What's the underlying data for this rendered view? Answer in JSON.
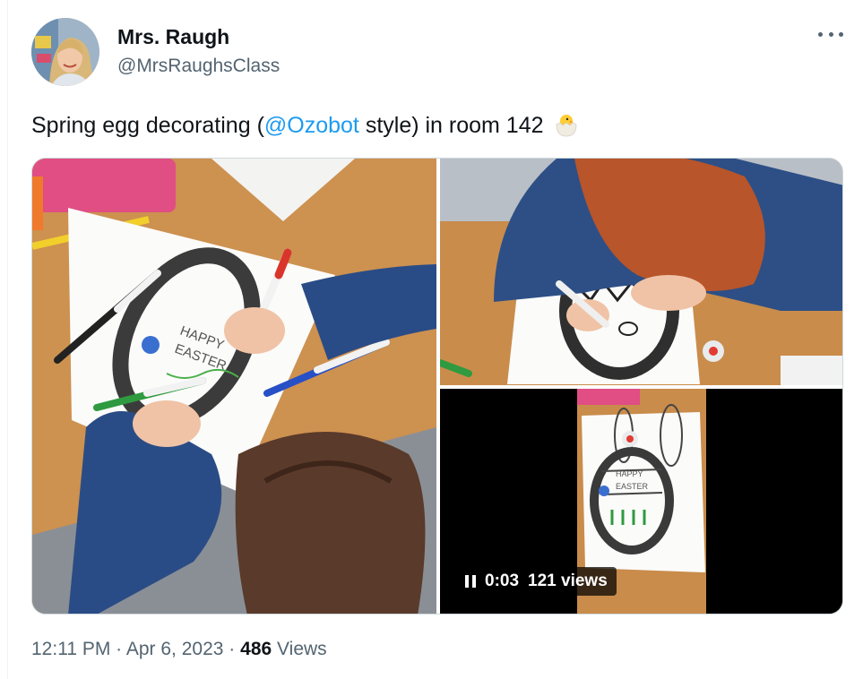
{
  "author": {
    "name": "Mrs. Raugh",
    "handle": "@MrsRaughsClass"
  },
  "tweet": {
    "text_before": "Spring egg decorating (",
    "mention": "@Ozobot",
    "text_after": " style) in room 142",
    "emoji": "hatching-chick-icon"
  },
  "media": {
    "video": {
      "time": "0:03",
      "views": "121 views"
    }
  },
  "meta": {
    "time": "12:11 PM",
    "separator": "·",
    "date": "Apr 6, 2023",
    "views_count": "486",
    "views_label": "Views"
  },
  "colors": {
    "link": "#1d9bf0",
    "secondary_text": "#536471",
    "primary_text": "#0f1419"
  }
}
